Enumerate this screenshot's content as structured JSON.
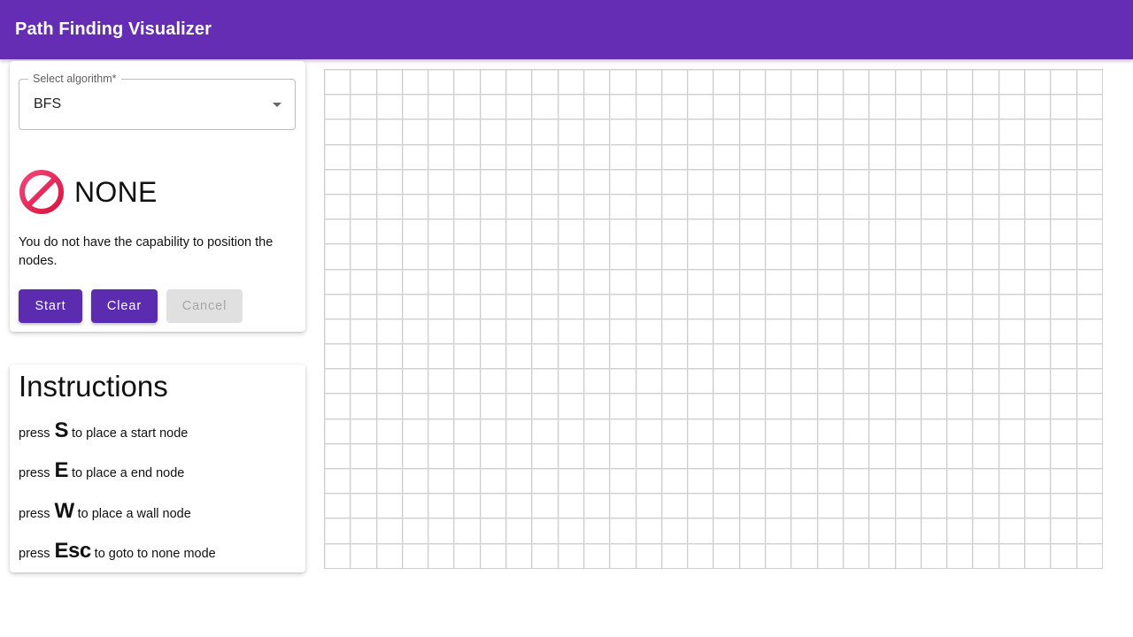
{
  "header": {
    "title": "Path Finding Visualizer"
  },
  "algorithm_select": {
    "label": "Select algorithm*",
    "value": "BFS"
  },
  "mode": {
    "name": "NONE",
    "icon": "no-entry-icon",
    "icon_color": "#e3204e",
    "description": "You do not have the capability to position the nodes."
  },
  "buttons": {
    "start": "Start",
    "clear": "Clear",
    "cancel": "Cancel"
  },
  "instructions": {
    "title": "Instructions",
    "items": [
      {
        "prefix": "press",
        "key": "S",
        "suffix": "to place a start node"
      },
      {
        "prefix": "press",
        "key": "E",
        "suffix": "to place a end node"
      },
      {
        "prefix": "press",
        "key": "W",
        "suffix": "to place a wall node"
      },
      {
        "prefix": "press",
        "key": "Esc",
        "suffix": "to goto to none mode"
      }
    ]
  },
  "grid": {
    "columns": 30,
    "rows": 20
  },
  "colors": {
    "appbar": "#652db3",
    "primary_button": "#5b2bb0",
    "disabled_button": "#e0e0e0"
  }
}
